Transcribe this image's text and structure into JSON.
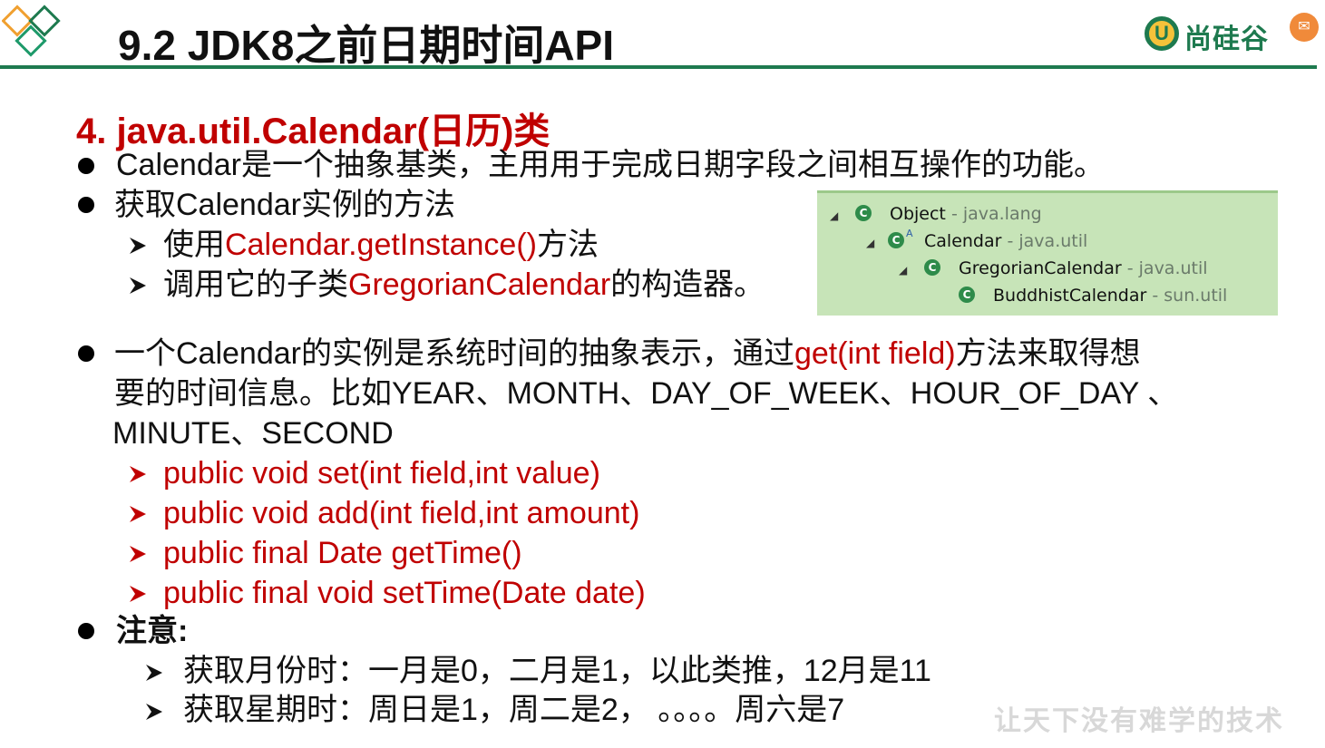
{
  "header": {
    "title": "9.2 JDK8之前日期时间API",
    "brand_text": "尚硅谷",
    "brand_mark": "U"
  },
  "section": {
    "heading": "4. java.util.Calendar(日历)类"
  },
  "bullets": {
    "b1": "Calendar是一个抽象基类，主用用于完成日期字段之间相互操作的功能。",
    "b2": "获取Calendar实例的方法",
    "b2_sub1_prefix": "使用",
    "b2_sub1_red": "Calendar.getInstance()",
    "b2_sub1_suffix": "方法",
    "b2_sub2_prefix": "调用它的子类",
    "b2_sub2_red": "GregorianCalendar",
    "b2_sub2_suffix": "的构造器。",
    "b3_line1_prefix": "一个Calendar的实例是系统时间的抽象表示，通过",
    "b3_line1_red": "get(int field)",
    "b3_line1_suffix": "方法来取得想",
    "b3_line2": "要的时间信息。比如YEAR、MONTH、DAY_OF_WEEK、HOUR_OF_DAY 、",
    "b3_line3": "MINUTE、SECOND",
    "methods": [
      "public void set(int field,int value)",
      "public void add(int field,int amount)",
      "public final Date getTime()",
      "public final void setTime(Date date)"
    ],
    "b4": "注意:",
    "note1": "获取月份时：一月是0，二月是1，以此类推，12月是11",
    "note2": "获取星期时：周日是1，周二是2， 。。。。周六是7"
  },
  "tree": {
    "rows": [
      {
        "name": "Object",
        "pkg": "- java.lang"
      },
      {
        "name": "Calendar",
        "pkg": "- java.util"
      },
      {
        "name": "GregorianCalendar",
        "pkg": "- java.util"
      },
      {
        "name": "BuddhistCalendar",
        "pkg": "- sun.util"
      }
    ],
    "class_icon": "C",
    "abstract_marker": "A"
  },
  "watermark": "让天下没有难学的技术",
  "colors": {
    "accent_green": "#1e7a4f",
    "highlight_red": "#c00000",
    "tree_bg": "#c7e4b8"
  }
}
